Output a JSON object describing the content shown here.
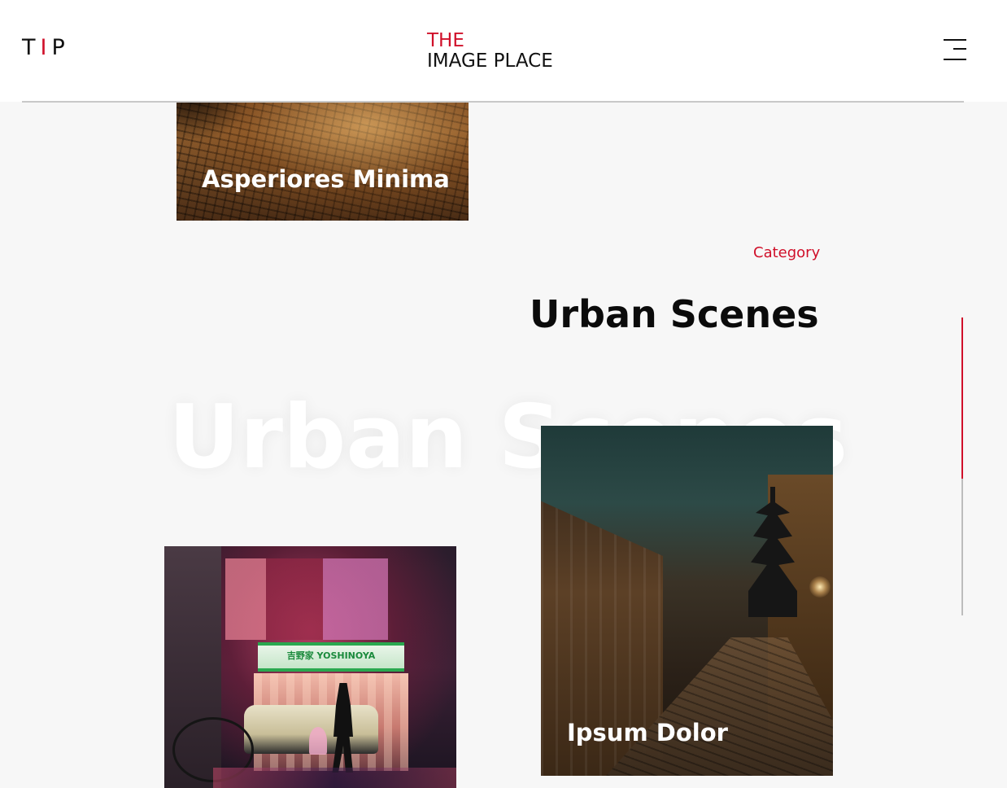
{
  "header": {
    "logo_left": "T",
    "logo_mid": "I",
    "logo_right": "P",
    "brand_line1": "THE",
    "brand_line2": "IMAGE PLACE",
    "menu_icon": "hamburger-menu-icon"
  },
  "cards": [
    {
      "title": "Asperiores Minima"
    },
    {
      "title": "Ipsum Dolor"
    }
  ],
  "section": {
    "category_label": "Category",
    "title": "Urban Scenes",
    "ghost_title": "Urban Scenes"
  },
  "images": {
    "yoshinoya_sign": "吉野家 YOSHINOYA"
  },
  "colors": {
    "accent": "#d0102a",
    "background": "#f7f7f7",
    "text": "#111111"
  },
  "scroll": {
    "progress": 0.54
  }
}
